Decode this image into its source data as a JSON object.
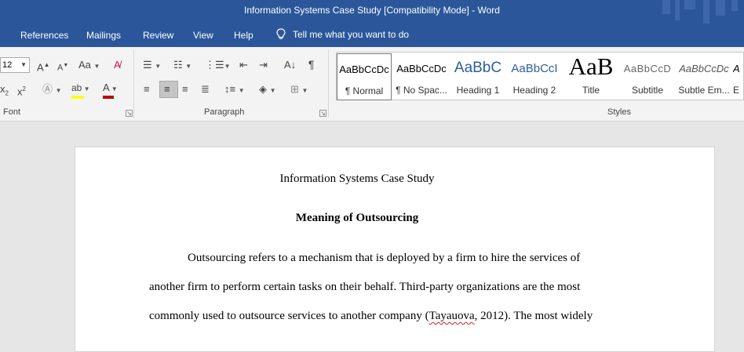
{
  "window": {
    "title": "Information Systems Case Study [Compatibility Mode]  -  Word"
  },
  "menu": {
    "tabs": [
      "References",
      "Mailings",
      "Review",
      "View",
      "Help"
    ],
    "tell_me": "Tell me what you want to do"
  },
  "ribbon": {
    "font_size": "12",
    "groups": {
      "font": "Font",
      "paragraph": "Paragraph",
      "styles": "Styles"
    },
    "styles": [
      {
        "preview": "AaBbCcDc",
        "name": "¶ Normal"
      },
      {
        "preview": "AaBbCcDc",
        "name": "¶ No Spac..."
      },
      {
        "preview": "AaBbC",
        "name": "Heading 1"
      },
      {
        "preview": "AaBbCcI",
        "name": "Heading 2"
      },
      {
        "preview": "AaB",
        "name": "Title"
      },
      {
        "preview": "AaBbCcD",
        "name": "Subtitle"
      },
      {
        "preview": "AaBbCcDc",
        "name": "Subtle Em..."
      },
      {
        "preview": "A",
        "name": "E"
      }
    ],
    "selected_style": "¶ Normal",
    "selected_alignment": "center"
  },
  "document": {
    "title": "Information Systems Case Study",
    "heading": "Meaning of Outsourcing",
    "lines": [
      "Outsourcing refers to a mechanism that is deployed by a firm to hire the services of",
      "another firm to perform certain tasks on their behalf. Third-party organizations are the most"
    ],
    "line3": {
      "before": "commonly used to outsource services to another company (",
      "flagged": "Tayauova",
      "after": ", 2012). The most widely"
    }
  },
  "colors": {
    "brand": "#2b579a",
    "highlight": "#ffff00",
    "font_color": "#c00000",
    "spell_error": "#d02020"
  }
}
